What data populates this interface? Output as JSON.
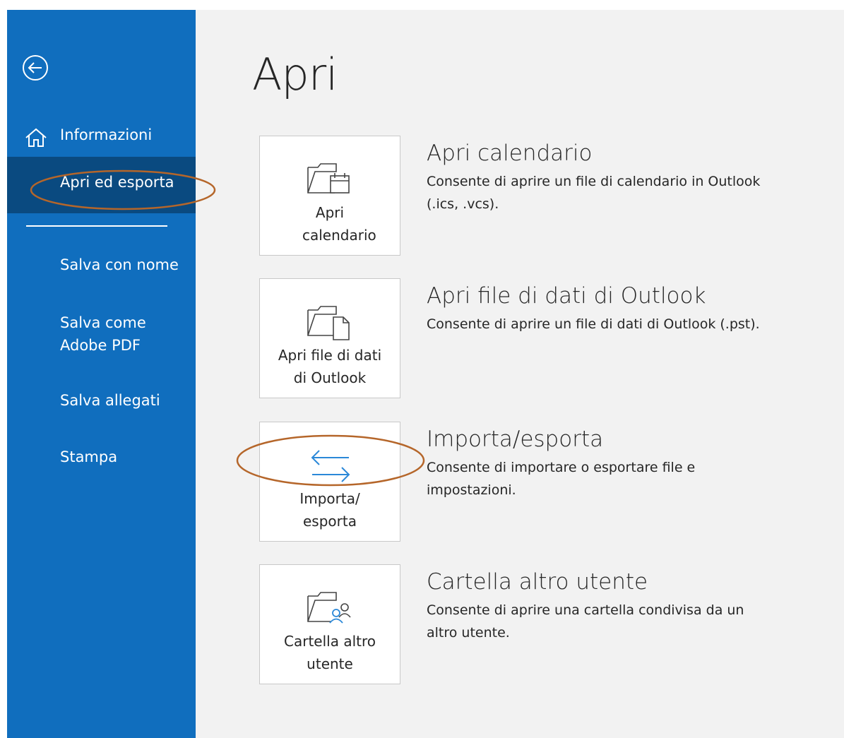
{
  "sidebar": {
    "back_icon": "back-arrow-circle-icon",
    "items": [
      {
        "label": "Informazioni",
        "icon": "home-icon"
      },
      {
        "label": "Apri ed esporta",
        "active": true
      },
      {
        "label": "Salva con nome"
      },
      {
        "label": "Salva come Adobe PDF"
      },
      {
        "label": "Salva allegati"
      },
      {
        "label": "Stampa"
      }
    ]
  },
  "main": {
    "title": "Apri",
    "options": [
      {
        "tile_label": "Apri calendario",
        "title": "Apri calendario",
        "description": "Consente di aprire un file di calendario in Outlook (.ics, .vcs).",
        "icon": "folder-calendar-icon"
      },
      {
        "tile_label": "Apri file di dati di Outlook",
        "title": "Apri file di dati di Outlook",
        "description": "Consente di aprire un file di dati di Outlook (.pst).",
        "icon": "folder-file-icon"
      },
      {
        "tile_label": "Importa/ esporta",
        "title": "Importa/esporta",
        "description": "Consente di importare o esportare file e impostazioni.",
        "icon": "import-export-arrows-icon"
      },
      {
        "tile_label": "Cartella altro utente",
        "title": "Cartella altro utente",
        "description": "Consente di aprire una cartella condivisa da un altro utente.",
        "icon": "folder-user-icon"
      }
    ]
  },
  "colors": {
    "sidebar_bg": "#106ebe",
    "sidebar_active": "#0a4a80",
    "main_bg": "#f2f2f2",
    "annotation": "#b5662a",
    "accent_icon": "#2b88d8"
  }
}
